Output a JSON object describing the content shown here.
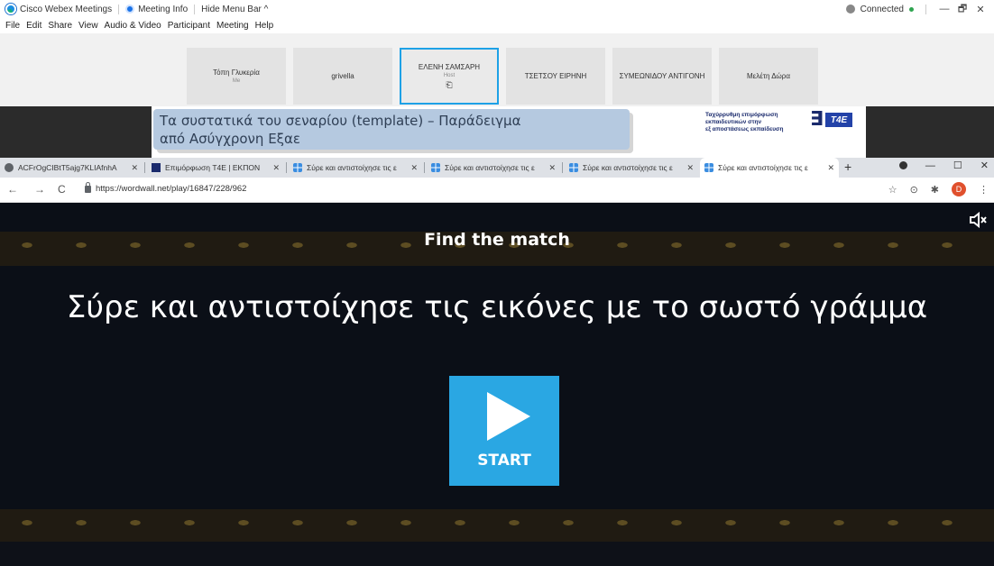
{
  "webex": {
    "app_name": "Cisco Webex Meetings",
    "meeting_info": "Meeting Info",
    "hide_menu_bar": "Hide Menu Bar ^",
    "status": "Connected",
    "window_controls": [
      "—",
      "🗗",
      "✕"
    ],
    "menu": [
      "File",
      "Edit",
      "Share",
      "View",
      "Audio & Video",
      "Participant",
      "Meeting",
      "Help"
    ]
  },
  "participants": [
    {
      "name": "Τόπη Γλυκερία",
      "role": "Me"
    },
    {
      "name": "grivella",
      "role": ""
    },
    {
      "name": "ΕΛΕΝΗ ΣΑΜΣΑΡΗ",
      "role": "Host",
      "active": true
    },
    {
      "name": "ΤΣΕΤΣΟΥ ΕΙΡΗΝΗ",
      "role": ""
    },
    {
      "name": "ΣΥΜΕΩΝΙΔΟΥ ΑΝΤΙΓΟΝΗ",
      "role": ""
    },
    {
      "name": "Μελέτη Δώρα",
      "role": ""
    }
  ],
  "slide": {
    "title_line1": "Τα συστατικά του σεναρίου (template) – Παράδειγμα",
    "title_line2": "από Ασύγχρονη Εξαε",
    "t4e_line1": "Ταχύρρυθμη επιμόρφωση",
    "t4e_line2": "εκπαιδευτικών στην",
    "t4e_line3": "εξ αποστάσεως εκπαίδευση",
    "t4e_logo_e": "∃",
    "t4e_logo_box": "T4E"
  },
  "browser": {
    "tabs": [
      {
        "label": "ACFrOgCIBtT5ajg7KLIAfnhA",
        "icon": "globe-icon"
      },
      {
        "label": "Επιμόρφωση T4E | ΕΚΠΟΝ",
        "icon": "t4e-icon"
      },
      {
        "label": "Σύρε και αντιστοίχησε τις ε",
        "icon": "wordwall-icon"
      },
      {
        "label": "Σύρε και αντιστοίχησε τις ε",
        "icon": "wordwall-icon"
      },
      {
        "label": "Σύρε και αντιστοίχησε τις ε",
        "icon": "wordwall-icon"
      },
      {
        "label": "Σύρε και αντιστοίχησε τις ε",
        "icon": "wordwall-icon",
        "active": true
      }
    ],
    "new_tab": "+",
    "url": "https://wordwall.net/play/16847/228/962",
    "avatar_letter": "D"
  },
  "game": {
    "header": "Find the match",
    "instructions": "Σύρε και αντιστοίχησε τις εικόνες με το σωστό γράμμα",
    "start_label": "START",
    "colors": {
      "start_button": "#2aa7e3",
      "background": "#0b0f17"
    }
  }
}
